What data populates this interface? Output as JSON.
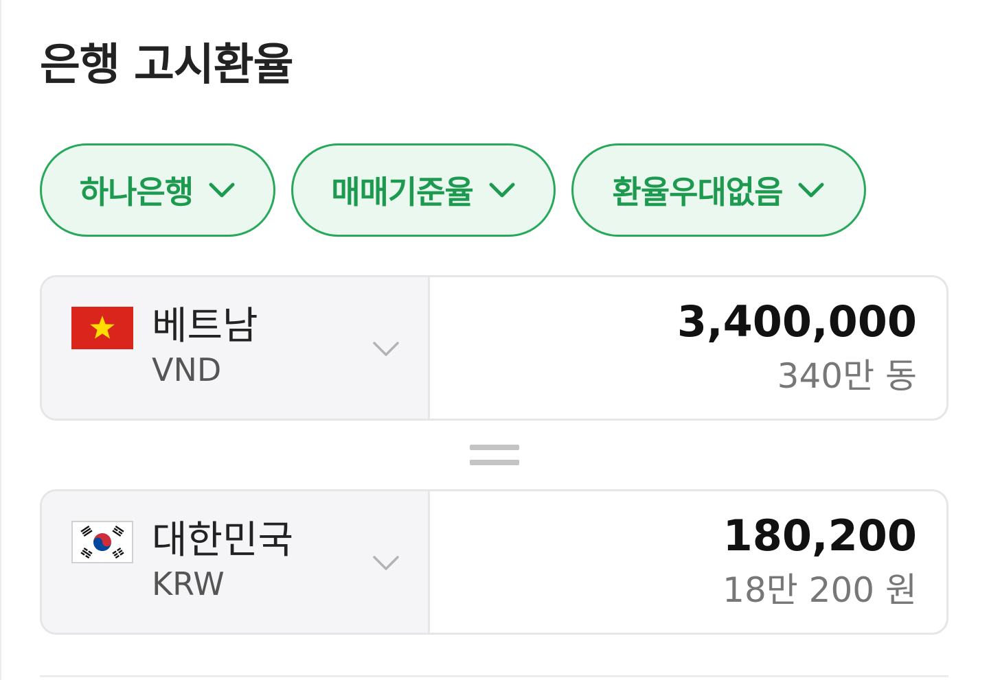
{
  "title": "은행 고시환율",
  "filters": [
    {
      "label": "하나은행"
    },
    {
      "label": "매매기준율"
    },
    {
      "label": "환율우대없음"
    }
  ],
  "from": {
    "country": "베트남",
    "code": "VND",
    "amount": "3,400,000",
    "amount_readable": "340만 동",
    "flag": "vietnam-flag-icon"
  },
  "to": {
    "country": "대한민국",
    "code": "KRW",
    "amount": "180,200",
    "amount_readable": "18만 200 원",
    "flag": "south-korea-flag-icon"
  },
  "equals_icon": "equals-icon",
  "colors": {
    "accent": "#27a85b",
    "accent_bg": "#ebf8ef",
    "vn_red": "#da251d",
    "vn_star": "#ffdd00"
  }
}
